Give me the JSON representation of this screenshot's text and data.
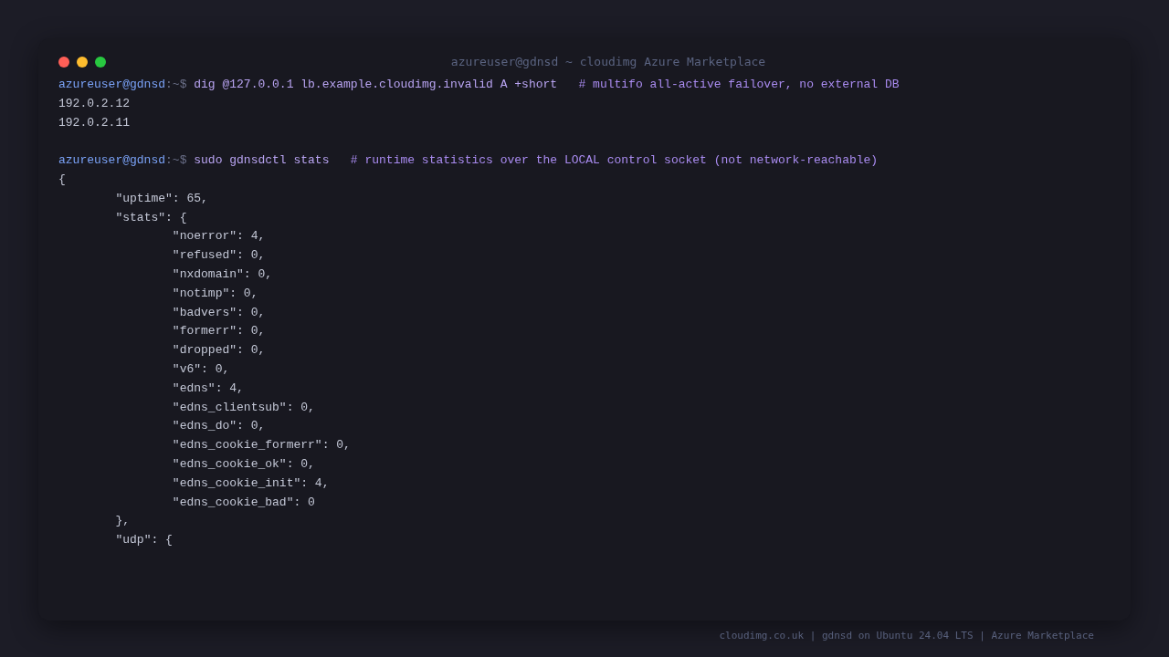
{
  "window": {
    "title": "azureuser@gdnsd ~ cloudimg Azure Marketplace",
    "controls": [
      {
        "color": "#ff5f57"
      },
      {
        "color": "#febc2e"
      },
      {
        "color": "#28c840"
      }
    ]
  },
  "terminal": {
    "lines": [
      {
        "kind": "command",
        "prompt_user": "azureuser@gdnsd",
        "prompt_path": ":~$",
        "command": "dig @127.0.0.1 lb.example.cloudimg.invalid A +short",
        "comment": "# multifo all-active failover, no external DB"
      },
      {
        "kind": "output",
        "text": "192.0.2.12"
      },
      {
        "kind": "output",
        "text": "192.0.2.11"
      },
      {
        "kind": "blank"
      },
      {
        "kind": "command",
        "prompt_user": "azureuser@gdnsd",
        "prompt_path": ":~$",
        "command": "sudo gdnsdctl stats",
        "comment": "# runtime statistics over the LOCAL control socket (not network-reachable)"
      },
      {
        "kind": "output",
        "text": "{"
      },
      {
        "kind": "output",
        "text": "\t\"uptime\": 65,"
      },
      {
        "kind": "output",
        "text": "\t\"stats\": {"
      },
      {
        "kind": "output",
        "text": "\t\t\"noerror\": 4,"
      },
      {
        "kind": "output",
        "text": "\t\t\"refused\": 0,"
      },
      {
        "kind": "output",
        "text": "\t\t\"nxdomain\": 0,"
      },
      {
        "kind": "output",
        "text": "\t\t\"notimp\": 0,"
      },
      {
        "kind": "output",
        "text": "\t\t\"badvers\": 0,"
      },
      {
        "kind": "output",
        "text": "\t\t\"formerr\": 0,"
      },
      {
        "kind": "output",
        "text": "\t\t\"dropped\": 0,"
      },
      {
        "kind": "output",
        "text": "\t\t\"v6\": 0,"
      },
      {
        "kind": "output",
        "text": "\t\t\"edns\": 4,"
      },
      {
        "kind": "output",
        "text": "\t\t\"edns_clientsub\": 0,"
      },
      {
        "kind": "output",
        "text": "\t\t\"edns_do\": 0,"
      },
      {
        "kind": "output",
        "text": "\t\t\"edns_cookie_formerr\": 0,"
      },
      {
        "kind": "output",
        "text": "\t\t\"edns_cookie_ok\": 0,"
      },
      {
        "kind": "output",
        "text": "\t\t\"edns_cookie_init\": 4,"
      },
      {
        "kind": "output",
        "text": "\t\t\"edns_cookie_bad\": 0"
      },
      {
        "kind": "output",
        "text": "\t},"
      },
      {
        "kind": "output",
        "text": "\t\"udp\": {"
      }
    ]
  },
  "footer": {
    "text": "cloudimg.co.uk | gdnsd on Ubuntu 24.04 LTS | Azure Marketplace"
  }
}
